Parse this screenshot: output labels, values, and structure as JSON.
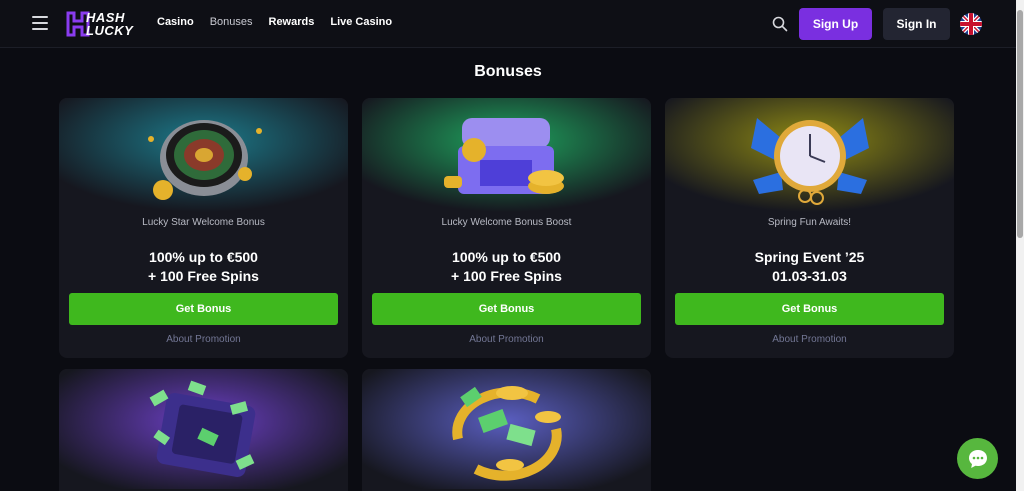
{
  "header": {
    "logo_line1": "HASH",
    "logo_line2": "LUCKY",
    "nav": [
      "Casino",
      "Bonuses",
      "Rewards",
      "Live Casino"
    ],
    "active_nav": "Bonuses",
    "signup_label": "Sign Up",
    "signin_label": "Sign In",
    "language_icon": "uk-flag-icon"
  },
  "page": {
    "title": "Bonuses"
  },
  "cards": [
    {
      "subtitle": "Lucky Star Welcome Bonus",
      "offer_line1": "100% up to €500",
      "offer_line2": "+ 100 Free Spins",
      "button": "Get Bonus",
      "link": "About Promotion",
      "icon": "roulette-wheel-icon"
    },
    {
      "subtitle": "Lucky Welcome Bonus Boost",
      "offer_line1": "100% up to €500",
      "offer_line2": "+ 100 Free Spins",
      "button": "Get Bonus",
      "link": "About Promotion",
      "icon": "treasure-chest-icon"
    },
    {
      "subtitle": "Spring Fun Awaits!",
      "offer_line1": "Spring Event ’25",
      "offer_line2": "01.03-31.03",
      "button": "Get Bonus",
      "link": "About Promotion",
      "icon": "winged-pocket-watch-icon"
    },
    {
      "icon": "money-briefcase-icon"
    },
    {
      "icon": "cashback-coins-icon"
    }
  ],
  "colors": {
    "accent_purple": "#7a2fe0",
    "cta_green": "#3fb81e",
    "chat_green": "#57b73e",
    "background": "#0b0c12"
  }
}
